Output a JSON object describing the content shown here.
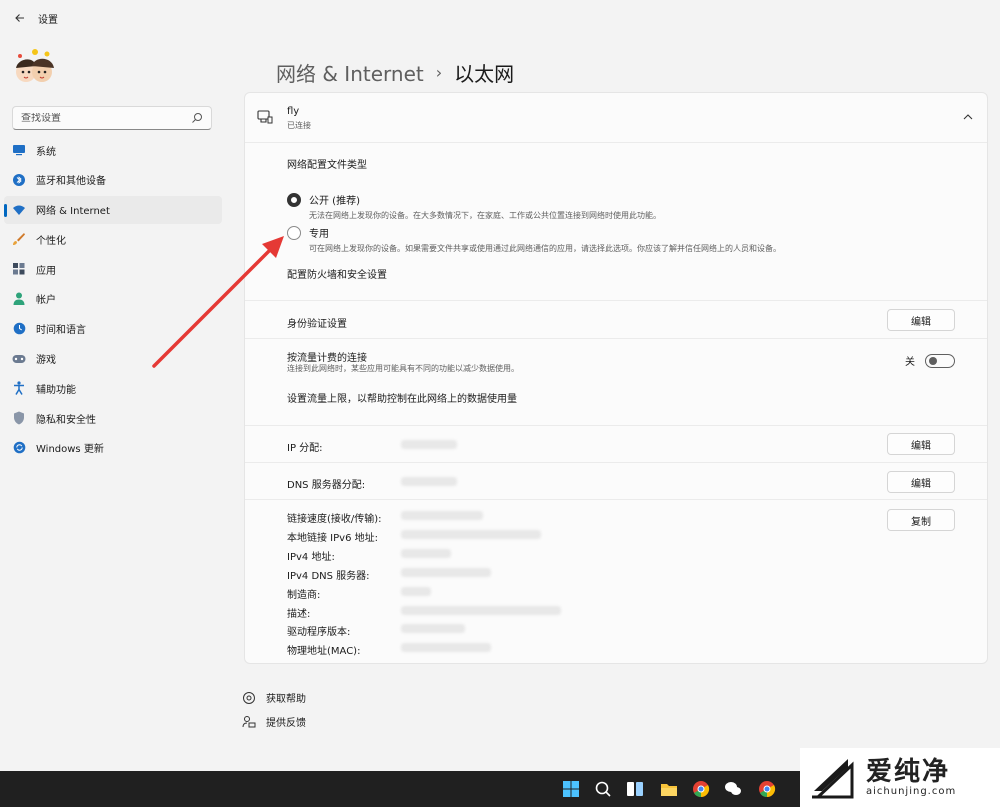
{
  "window": {
    "title": "设置"
  },
  "search": {
    "placeholder": "查找设置"
  },
  "sidebar": {
    "items": [
      {
        "label": "系统",
        "icon": "monitor-icon",
        "active": false
      },
      {
        "label": "蓝牙和其他设备",
        "icon": "bluetooth-icon",
        "active": false
      },
      {
        "label": "网络 & Internet",
        "icon": "wifi-icon",
        "active": true
      },
      {
        "label": "个性化",
        "icon": "brush-icon",
        "active": false
      },
      {
        "label": "应用",
        "icon": "apps-icon",
        "active": false
      },
      {
        "label": "帐户",
        "icon": "person-icon",
        "active": false
      },
      {
        "label": "时间和语言",
        "icon": "globe-clock-icon",
        "active": false
      },
      {
        "label": "游戏",
        "icon": "gamepad-icon",
        "active": false
      },
      {
        "label": "辅助功能",
        "icon": "accessibility-icon",
        "active": false
      },
      {
        "label": "隐私和安全性",
        "icon": "shield-icon",
        "active": false
      },
      {
        "label": "Windows 更新",
        "icon": "update-icon",
        "active": false
      }
    ]
  },
  "header": {
    "parent": "网络 & Internet",
    "separator": "›",
    "current": "以太网"
  },
  "network": {
    "name": "fly",
    "status": "已连接"
  },
  "profile": {
    "title": "网络配置文件类型",
    "options": [
      {
        "title": "公开 (推荐)",
        "desc": "无法在网络上发现你的设备。在大多数情况下，在家庭、工作或公共位置连接到网络时使用此功能。",
        "checked": true
      },
      {
        "title": "专用",
        "desc": "可在网络上发现你的设备。如果需要文件共享或使用通过此网络通信的应用，请选择此选项。你应该了解并信任网络上的人员和设备。",
        "checked": false
      }
    ],
    "firewall_link": "配置防火墙和安全设置"
  },
  "auth": {
    "label": "身份验证设置",
    "button": "编辑"
  },
  "metered": {
    "label": "按流量计费的连接",
    "desc": "连接到此网络时，某些应用可能具有不同的功能以减少数据使用。",
    "toggle_label": "关",
    "data_limit_link": "设置流量上限，以帮助控制在此网络上的数据使用量"
  },
  "ip": {
    "label": "IP 分配:",
    "button": "编辑"
  },
  "dns": {
    "label": "DNS 服务器分配:",
    "button": "编辑"
  },
  "properties": {
    "copy_button": "复制",
    "labels": [
      "链接速度(接收/传输):",
      "本地链接 IPv6 地址:",
      "IPv4 地址:",
      "IPv4 DNS 服务器:",
      "制造商:",
      "描述:",
      "驱动程序版本:",
      "物理地址(MAC):"
    ]
  },
  "footer": {
    "help": "获取帮助",
    "feedback": "提供反馈"
  },
  "watermark": {
    "cn": "爱纯净",
    "en": "aichunjing.com"
  },
  "colors": {
    "accent": "#0067c0",
    "annotation_arrow": "#e53935",
    "taskbar": "#202020"
  }
}
